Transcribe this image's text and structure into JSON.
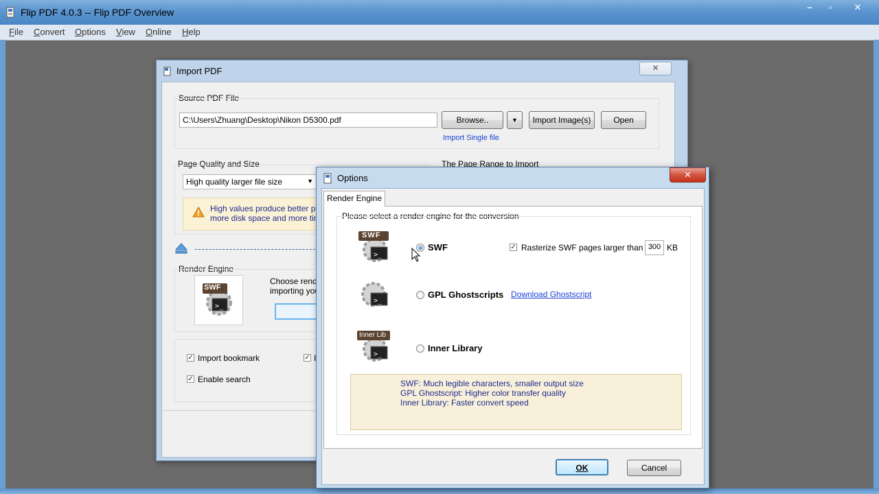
{
  "window": {
    "title": "Flip PDF 4.0.3  -- Flip PDF Overview",
    "controls": [
      "–",
      "▫",
      "✕"
    ]
  },
  "menu": [
    "File",
    "Convert",
    "Options",
    "View",
    "Online",
    "Help"
  ],
  "import_dialog": {
    "title": "Import PDF",
    "close": "✕",
    "source_label": "Source PDF File",
    "source_path": "C:\\Users\\Zhuang\\Desktop\\Nikon D5300.pdf",
    "browse_button": "Browse..",
    "dropdown_arrow": "▼",
    "import_images_button": "Import Image(s)",
    "open_button": "Open",
    "import_single_link": "Import Single file",
    "quality_label": "Page Quality and Size",
    "quality_value": "High quality larger file size",
    "page_range_label": "The Page Range to Import",
    "warning_line1": "High values produce better pa",
    "warning_line2": "more disk space and more tim",
    "render_engine_label": "Render Engine",
    "render_engine_icon_text": "SWF",
    "render_desc_line1": "Choose rend",
    "render_desc_line2": "importing you",
    "import_bookmark": "Import bookmark",
    "enable_search": "Enable search",
    "partial_checkbox_label": "I"
  },
  "options_dialog": {
    "title": "Options",
    "close": "✕",
    "tab_label": "Render Engine",
    "group_title": "Please select a render engine for the conversion",
    "engines": [
      {
        "name": "SWF",
        "badge": "SWF",
        "selected": true
      },
      {
        "name": "GPL Ghostscripts",
        "badge": "",
        "selected": false
      },
      {
        "name": "Inner Library",
        "badge": "Inner Lib",
        "selected": false
      }
    ],
    "rasterize_label": "Rasterize SWF pages larger than",
    "rasterize_value": "300",
    "rasterize_unit": "KB",
    "download_link": "Download Ghostscript",
    "info_lines": [
      "SWF: Much legible characters, smaller output size",
      "GPL Ghostscript: Higher color transfer quality",
      "Inner Library: Faster convert speed"
    ],
    "ok_button": "OK",
    "cancel_button": "Cancel"
  },
  "colors": {
    "titlebar": "#5c95cf",
    "workspace": "#6b6b6b",
    "link": "#1a3fd6",
    "info_bg": "#f8f0da",
    "close_red": "#c4321b"
  }
}
